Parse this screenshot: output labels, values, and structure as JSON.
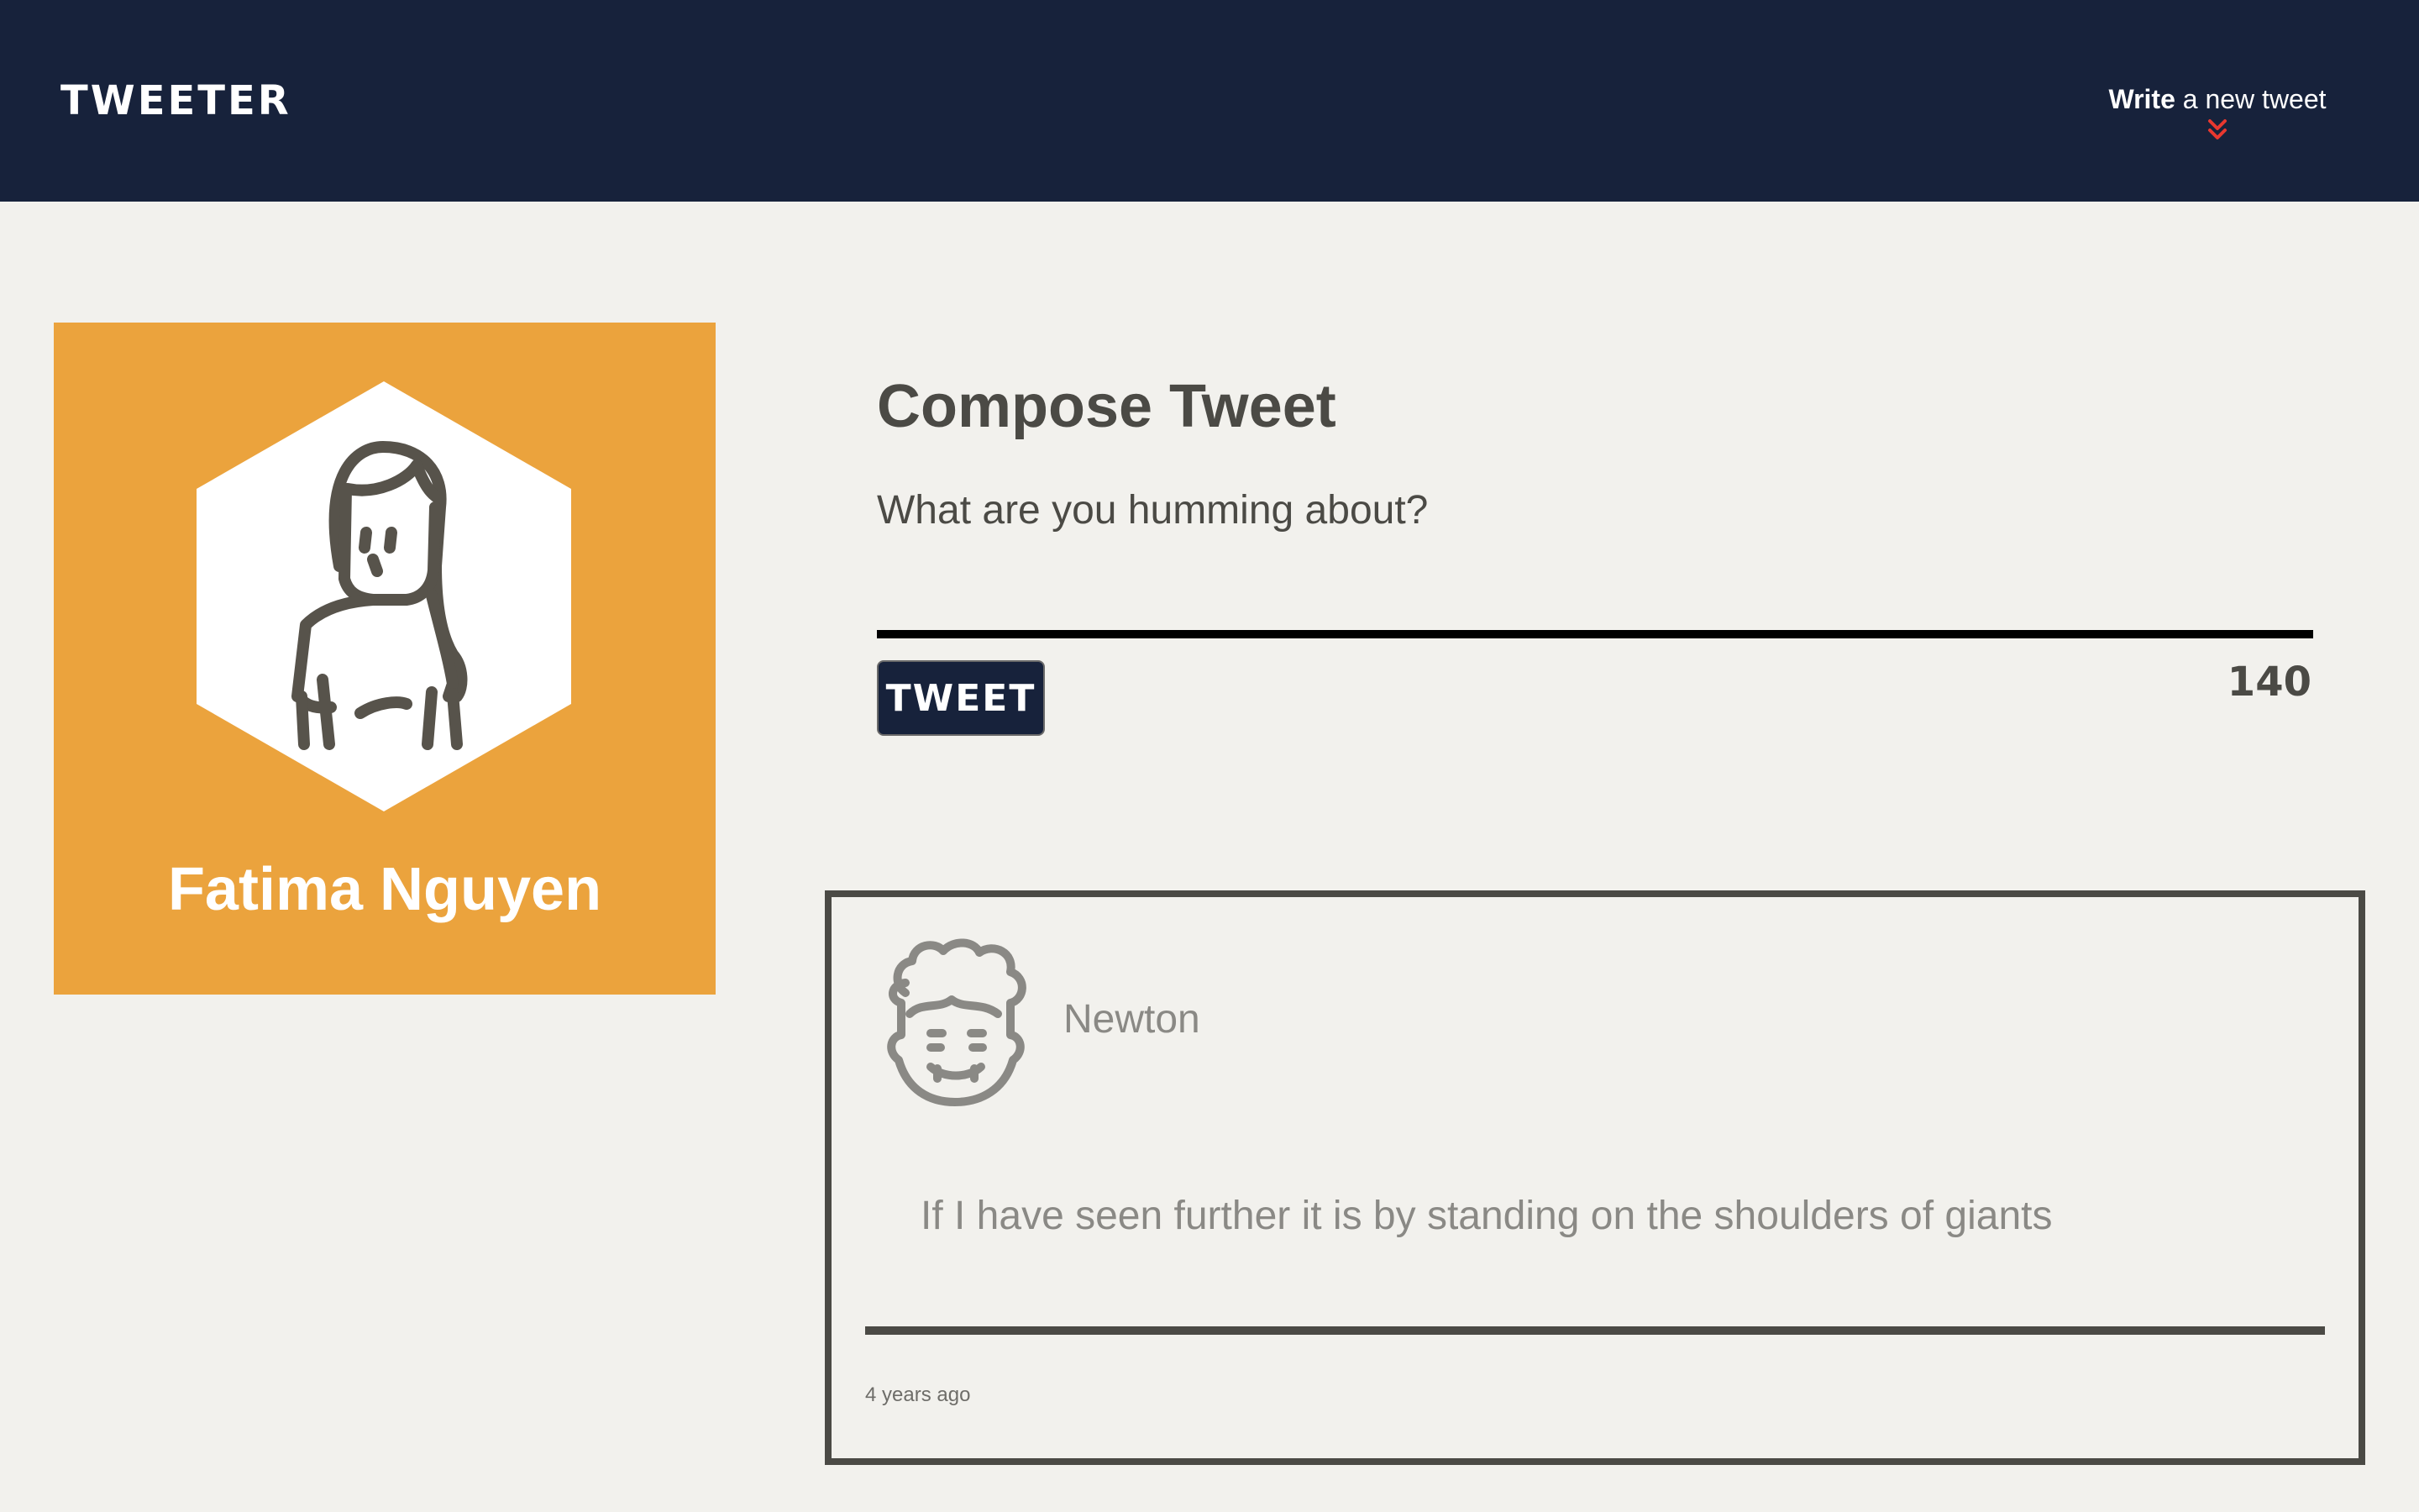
{
  "nav": {
    "brand": "TWEETER",
    "write_strong": "Write",
    "write_rest": " a new tweet",
    "chevron_icon": "double-chevron-down-icon",
    "chevron_color": "#e8382f",
    "background": "#17223b"
  },
  "profile": {
    "name": "Fatima Nguyen",
    "avatar_icon": "woman-avatar-icon",
    "background": "#eba33d"
  },
  "compose": {
    "title": "Compose Tweet",
    "placeholder": "What are you humming about?",
    "button_label": "TWEET",
    "counter": "140"
  },
  "tweets": [
    {
      "author": "Newton",
      "avatar_icon": "curly-hair-man-avatar-icon",
      "text": "If I have seen further it is by standing on the shoulders of giants",
      "time": "4 years ago"
    }
  ]
}
